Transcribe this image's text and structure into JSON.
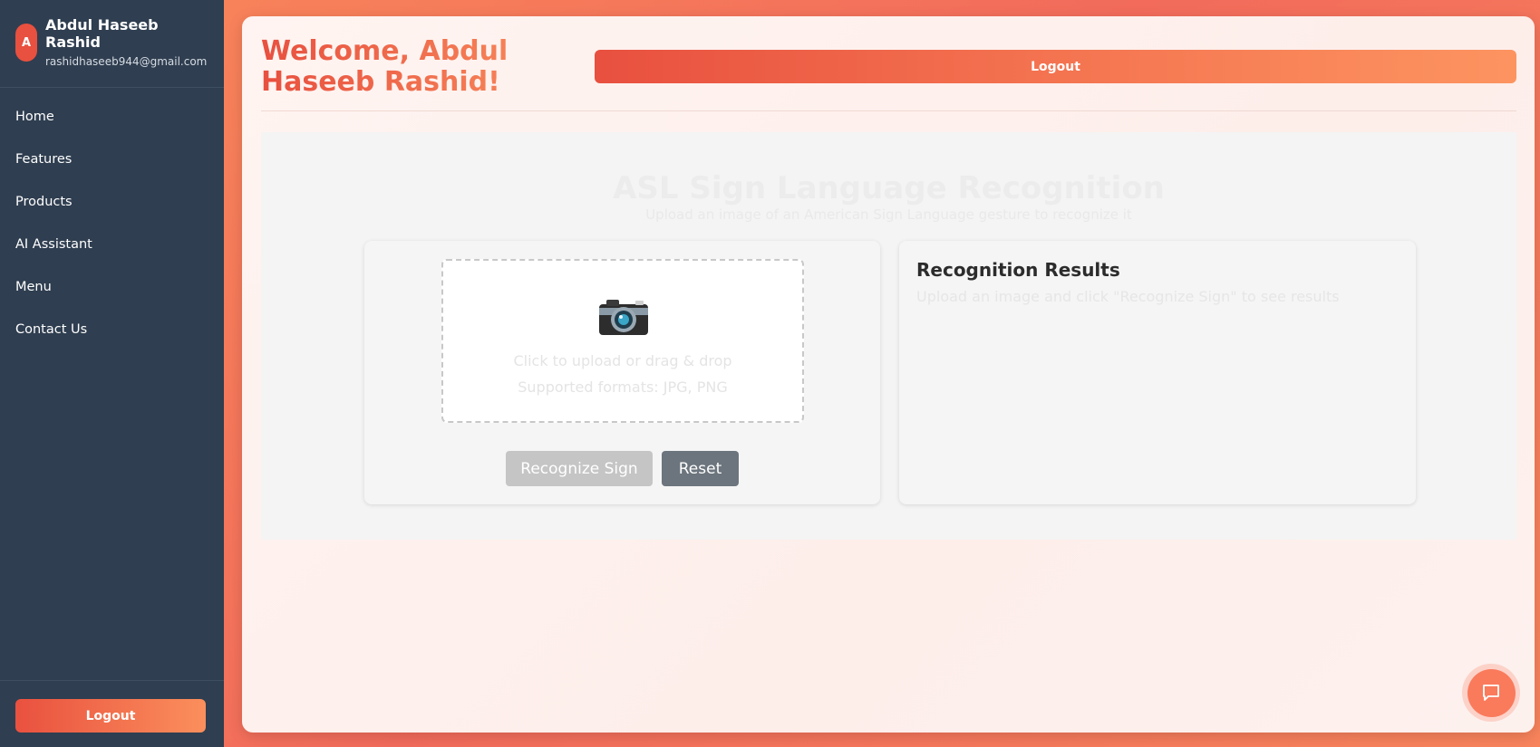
{
  "sidebar": {
    "user": {
      "initial": "A",
      "name": "Abdul Haseeb Rashid",
      "email": "rashidhaseeb944@gmail.com"
    },
    "items": [
      {
        "label": "Home"
      },
      {
        "label": "Features"
      },
      {
        "label": "Products"
      },
      {
        "label": "AI Assistant"
      },
      {
        "label": "Menu"
      },
      {
        "label": "Contact Us"
      }
    ],
    "logout_label": "Logout"
  },
  "header": {
    "welcome": "Welcome, Abdul Haseeb Rashid!",
    "logout_label": "Logout"
  },
  "asl": {
    "title": "ASL Sign Language Recognition",
    "subtitle": "Upload an image of an American Sign Language gesture to recognize it"
  },
  "upload": {
    "icon": "camera-icon",
    "prompt": "Click to upload or drag & drop",
    "formats": "Supported formats: JPG, PNG",
    "recognize_label": "Recognize Sign",
    "reset_label": "Reset"
  },
  "results": {
    "title": "Recognition Results",
    "hint": "Upload an image and click \"Recognize Sign\" to see results"
  },
  "chat": {
    "icon": "chat-icon"
  },
  "colors": {
    "sidebar_bg": "#2f3e50",
    "accent_start": "#e8503f",
    "accent_end": "#fb8f5c",
    "reset_bg": "#6c757d"
  }
}
